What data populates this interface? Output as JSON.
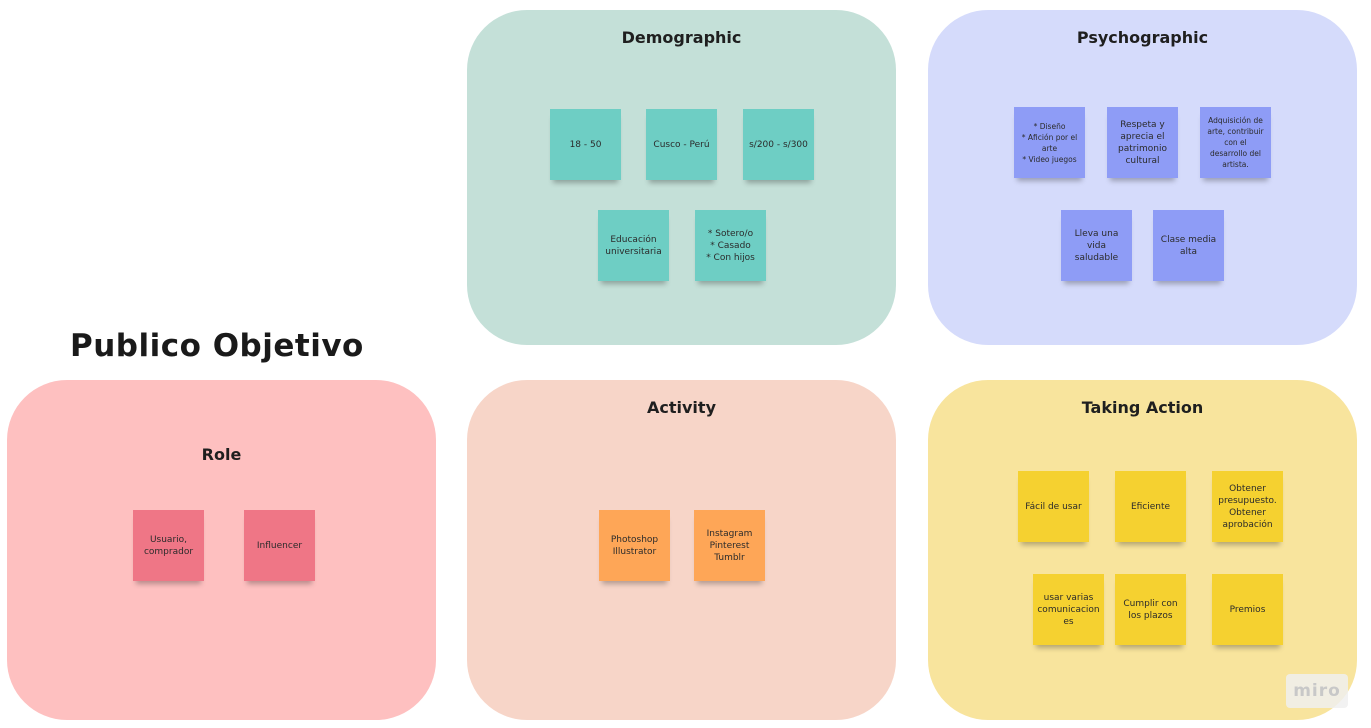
{
  "title": "Publico Objetivo",
  "colors": {
    "demographic_bg": "#c4e0d8",
    "psychographic_bg": "#d5dbfb",
    "role_bg": "#fec0c0",
    "activity_bg": "#f7d5c8",
    "taking_action_bg": "#f8e49d",
    "teal_note": "#6ecec4",
    "blue_note": "#8e9cf6",
    "pink_note": "#ef7686",
    "orange_note": "#fea657",
    "yellow_note": "#f5d130"
  },
  "panels": {
    "demographic": {
      "title": "Demographic",
      "notes": [
        "18 - 50",
        "Cusco - Perú",
        "s/200 - s/300",
        "Educación\nuniversitaria",
        "* Sotero/o\n* Casado\n* Con hijos"
      ]
    },
    "psychographic": {
      "title": "Psychographic",
      "notes": [
        "* Diseño\n* Afición por el\narte\n* Video juegos",
        "Respeta y\naprecia el\npatrimonio\ncultural",
        "Adquisición de\narte, contribuir\ncon el\ndesarrollo del\nartista.",
        "Lleva una\nvida\nsaludable",
        "Clase media\nalta"
      ]
    },
    "role": {
      "title": "Role",
      "notes": [
        "Usuario,\ncomprador",
        "Influencer"
      ]
    },
    "activity": {
      "title": "Activity",
      "notes": [
        "Photoshop\nIllustrator",
        "Instagram\nPinterest\nTumblr"
      ]
    },
    "taking_action": {
      "title": "Taking Action",
      "notes": [
        "Fácil de usar",
        "Eficiente",
        "Obtener\npresupuesto.\nObtener\naprobación",
        "usar varias\ncomunicacion\nes",
        "Cumplir con\nlos plazos",
        "Premios"
      ]
    }
  },
  "watermark": "miro"
}
